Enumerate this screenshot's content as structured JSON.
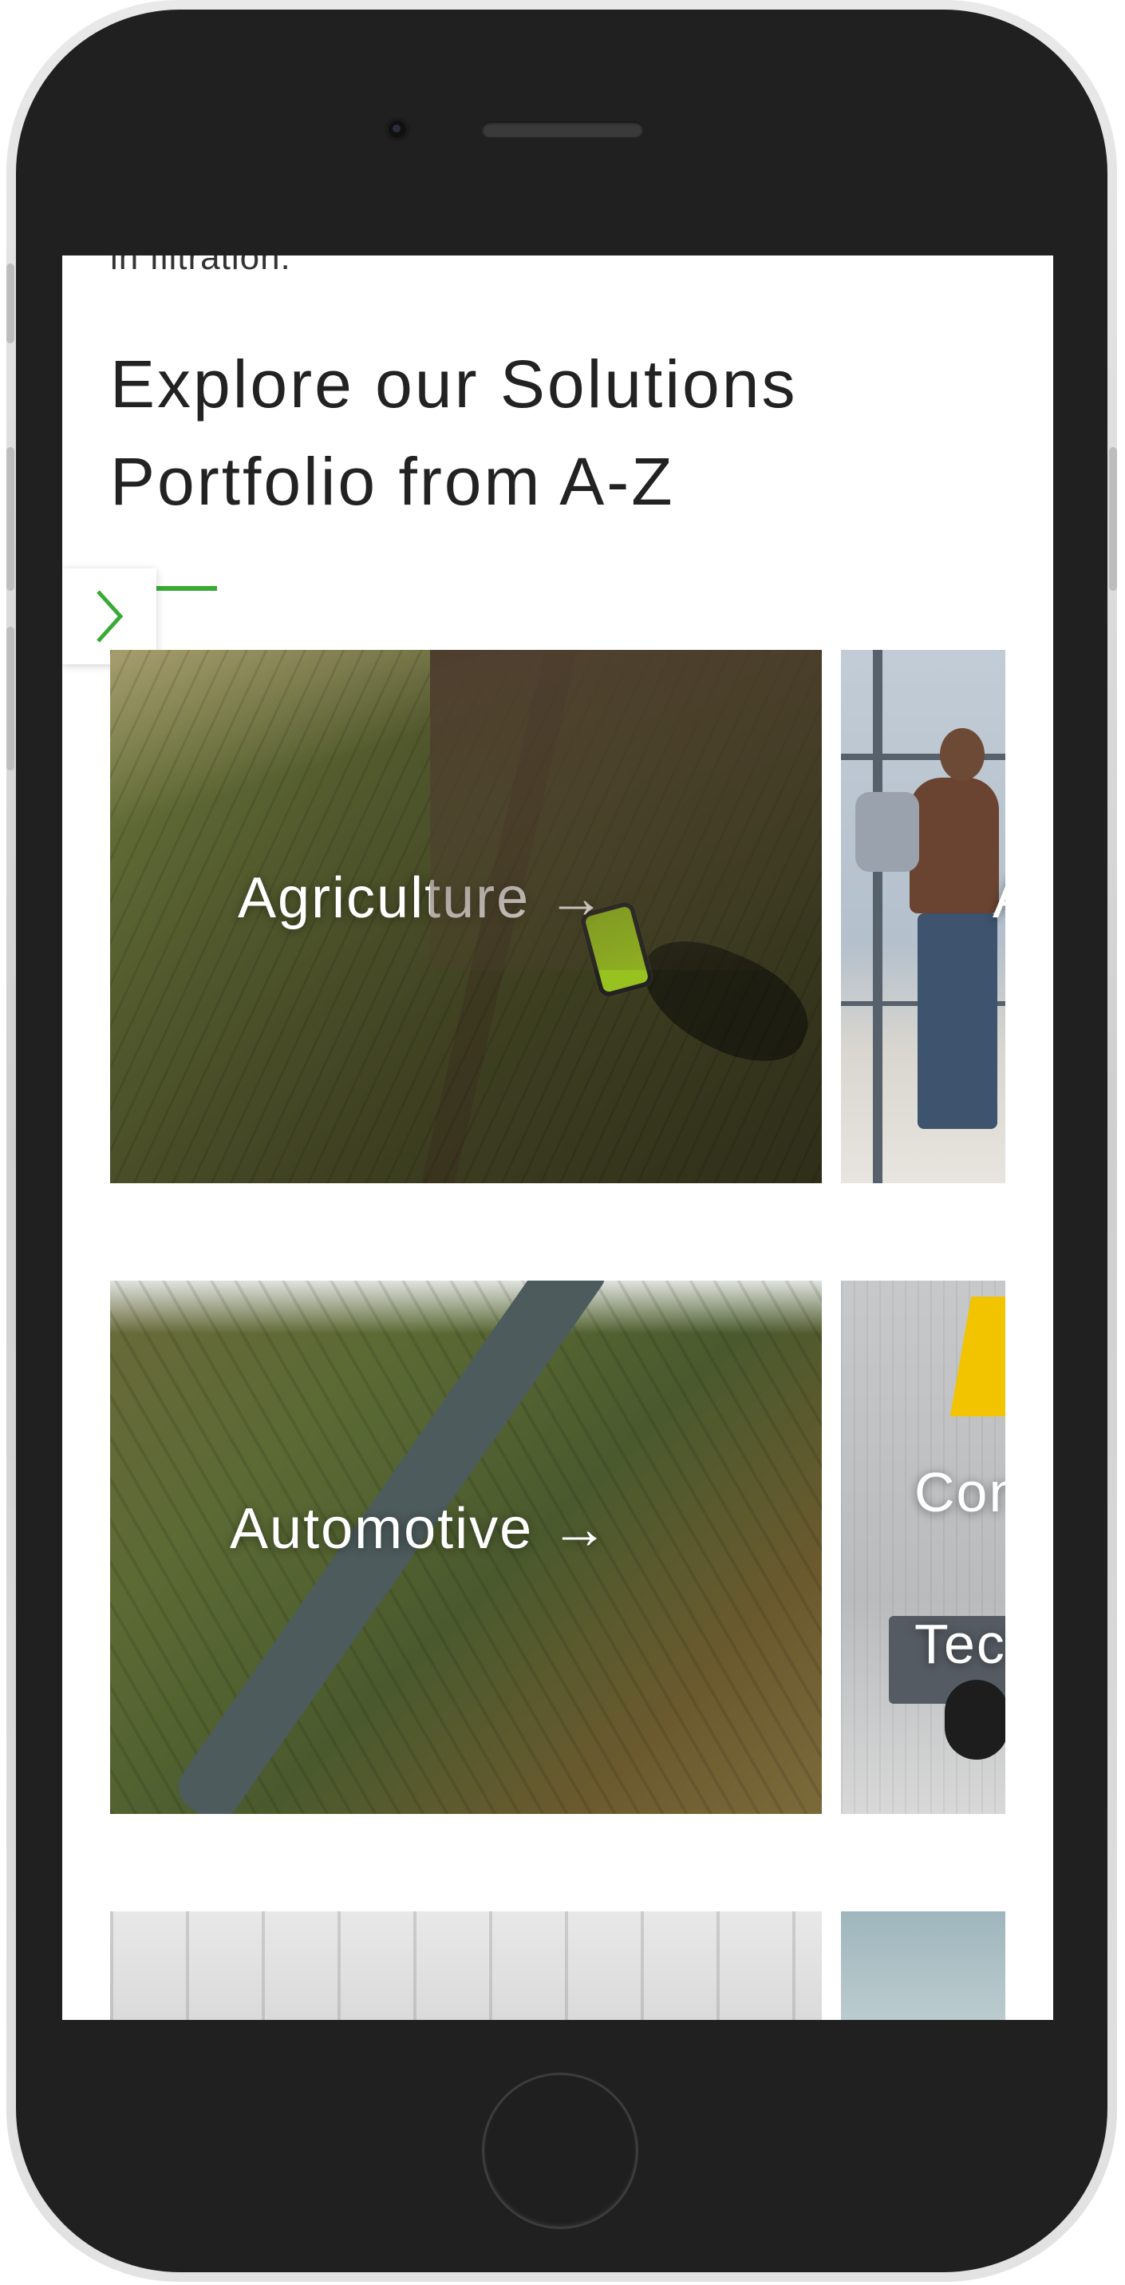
{
  "page": {
    "cut_off_text": "in filtration.",
    "heading": "Explore our Solutions Portfolio from A-Z"
  },
  "colors": {
    "accent": "#3aaa35",
    "heading_text": "#222222",
    "card_label": "#ffffff"
  },
  "navigation": {
    "next_icon": "chevron-right-icon"
  },
  "cards": [
    {
      "label": "Agriculture",
      "arrow": "→"
    },
    {
      "label": "Aviation",
      "arrow": "→"
    },
    {
      "label": "Automotive",
      "arrow": "→"
    },
    {
      "label": "Construction Technology",
      "arrow": "→"
    }
  ]
}
